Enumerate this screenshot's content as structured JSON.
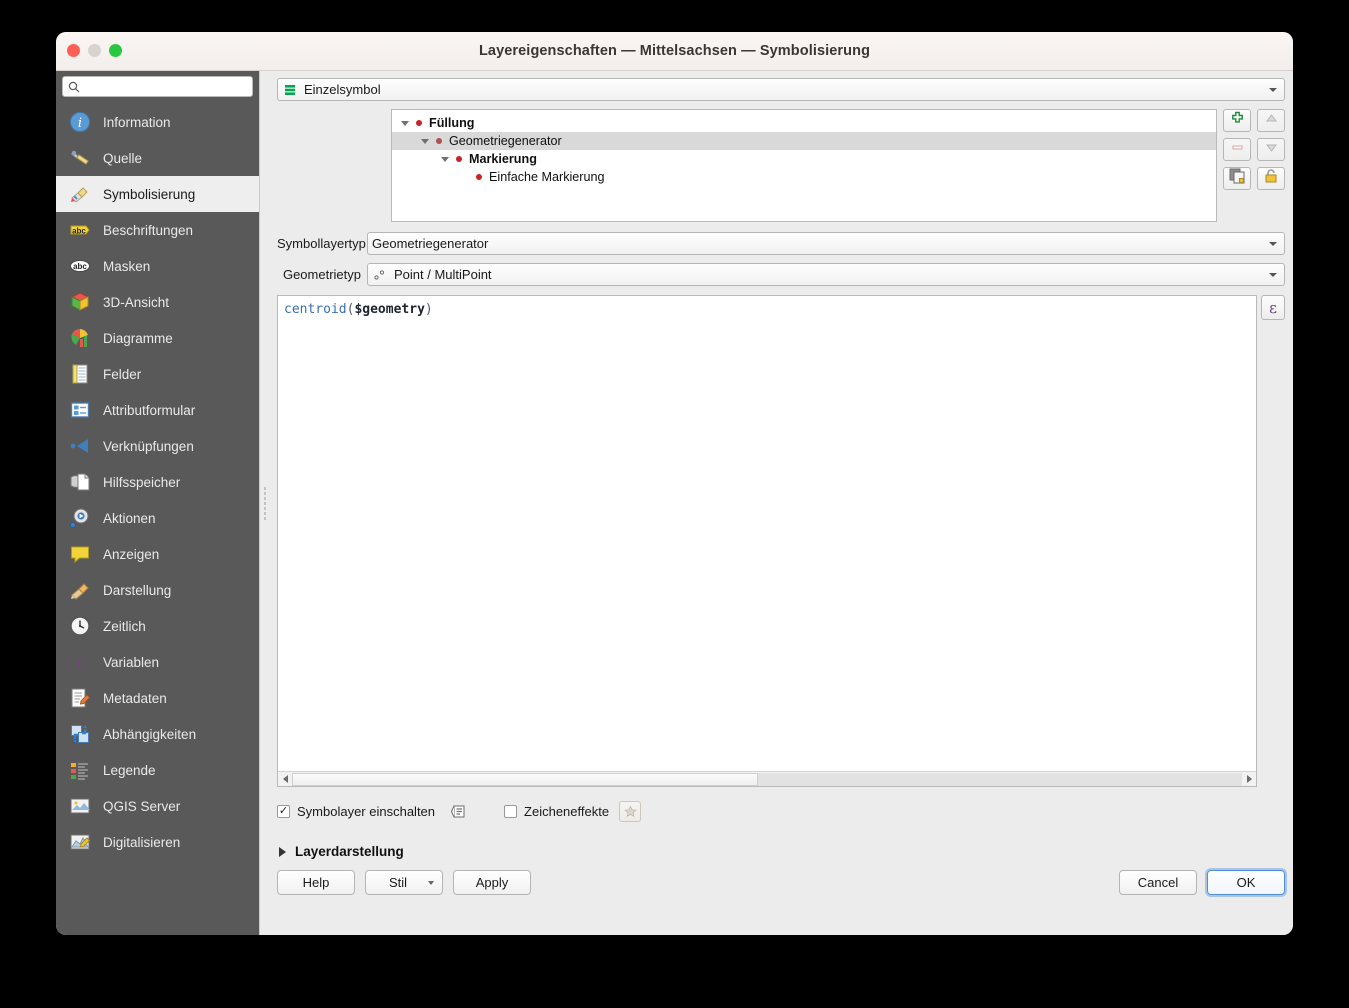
{
  "window": {
    "title": "Layereigenschaften — Mittelsachsen — Symbolisierung",
    "traffic_lights": [
      "close",
      "minimize",
      "zoom"
    ]
  },
  "sidebar": {
    "search": {
      "value": "",
      "placeholder": ""
    },
    "items": [
      {
        "label": "Information",
        "icon": "info-icon",
        "selected": false
      },
      {
        "label": "Quelle",
        "icon": "source-wrench-icon",
        "selected": false
      },
      {
        "label": "Symbolisierung",
        "icon": "paintbrush-icon",
        "selected": true
      },
      {
        "label": "Beschriftungen",
        "icon": "label-abc-icon",
        "selected": false
      },
      {
        "label": "Masken",
        "icon": "mask-abc-icon",
        "selected": false
      },
      {
        "label": "3D-Ansicht",
        "icon": "cube-3d-icon",
        "selected": false
      },
      {
        "label": "Diagramme",
        "icon": "chart-icon",
        "selected": false
      },
      {
        "label": "Felder",
        "icon": "table-fields-icon",
        "selected": false
      },
      {
        "label": "Attributformular",
        "icon": "form-icon",
        "selected": false
      },
      {
        "label": "Verknüpfungen",
        "icon": "join-icon",
        "selected": false
      },
      {
        "label": "Hilfsspeicher",
        "icon": "auxiliary-storage-icon",
        "selected": false
      },
      {
        "label": "Aktionen",
        "icon": "actions-gear-icon",
        "selected": false
      },
      {
        "label": "Anzeigen",
        "icon": "display-balloon-icon",
        "selected": false
      },
      {
        "label": "Darstellung",
        "icon": "rendering-brush-icon",
        "selected": false
      },
      {
        "label": "Zeitlich",
        "icon": "clock-icon",
        "selected": false
      },
      {
        "label": "Variablen",
        "icon": "epsilon-variables-icon",
        "selected": false
      },
      {
        "label": "Metadaten",
        "icon": "metadata-pencil-icon",
        "selected": false
      },
      {
        "label": "Abhängigkeiten",
        "icon": "dependencies-icon",
        "selected": false
      },
      {
        "label": "Legende",
        "icon": "legend-icon",
        "selected": false
      },
      {
        "label": "QGIS Server",
        "icon": "qgis-server-icon",
        "selected": false
      },
      {
        "label": "Digitalisieren",
        "icon": "digitizing-icon",
        "selected": false
      }
    ]
  },
  "renderer": {
    "type_label": "Einzelsymbol",
    "type_icon": "single-symbol-icon"
  },
  "symbol_tree": {
    "rows": [
      {
        "label": "Füllung",
        "depth": 0,
        "bold": true,
        "expanded": true,
        "selected": false,
        "bullet": "red"
      },
      {
        "label": "Geometriegenerator",
        "depth": 1,
        "bold": false,
        "expanded": true,
        "selected": true,
        "bullet": "muted"
      },
      {
        "label": "Markierung",
        "depth": 2,
        "bold": true,
        "expanded": true,
        "selected": false,
        "bullet": "red"
      },
      {
        "label": "Einfache Markierung",
        "depth": 3,
        "bold": false,
        "expanded": false,
        "selected": false,
        "bullet": "red"
      }
    ],
    "buttons": [
      {
        "name": "add-symbol-layer",
        "icon": "green-plus-icon",
        "enabled": true
      },
      {
        "name": "move-up",
        "icon": "arrow-up-icon",
        "enabled": false
      },
      {
        "name": "remove-symbol-layer",
        "icon": "minus-icon",
        "enabled": false
      },
      {
        "name": "move-down",
        "icon": "arrow-down-icon",
        "enabled": false
      },
      {
        "name": "duplicate-layer",
        "icon": "duplicate-icon",
        "enabled": true
      },
      {
        "name": "lock-layer",
        "icon": "lock-icon",
        "enabled": true
      }
    ]
  },
  "form": {
    "symbol_layer_type": {
      "label": "Symbollayertyp",
      "value": "Geometriegenerator"
    },
    "geometry_type": {
      "label": "Geometrietyp",
      "value": "Point / MultiPoint",
      "icon": "point-multipoint-icon"
    }
  },
  "expression": {
    "tokens": [
      {
        "text": "centroid",
        "kind": "fn"
      },
      {
        "text": "(",
        "kind": "par"
      },
      {
        "text": "$geometry",
        "kind": "var"
      },
      {
        "text": ")",
        "kind": "par"
      }
    ],
    "full_text": "centroid($geometry)",
    "expression_button_label": "ε",
    "scrollbar": {
      "thumb_fraction": 0.49
    }
  },
  "options": {
    "enable_symbol_layer": {
      "label": "Symbolayer einschalten",
      "checked": true
    },
    "draw_effects": {
      "label": "Zeicheneffekte",
      "checked": false
    },
    "data_defined_icon": "data-defined-override-icon",
    "effects_icon": "effects-star-icon"
  },
  "collapsible": {
    "label": "Layerdarstellung",
    "expanded": false
  },
  "footer": {
    "help": "Help",
    "style": "Stil",
    "apply": "Apply",
    "cancel": "Cancel",
    "ok": "OK"
  },
  "colors": {
    "titlebar": "#f5f0ee",
    "sidebar": "#595959",
    "sidebar_selected": "#eeeeee",
    "content": "#ececec",
    "accent_focus": "#4f8fd6",
    "bullet_red": "#cc2222",
    "symbol_icon_green": "#00a651",
    "expr_fn_blue": "#3a6fb5"
  }
}
